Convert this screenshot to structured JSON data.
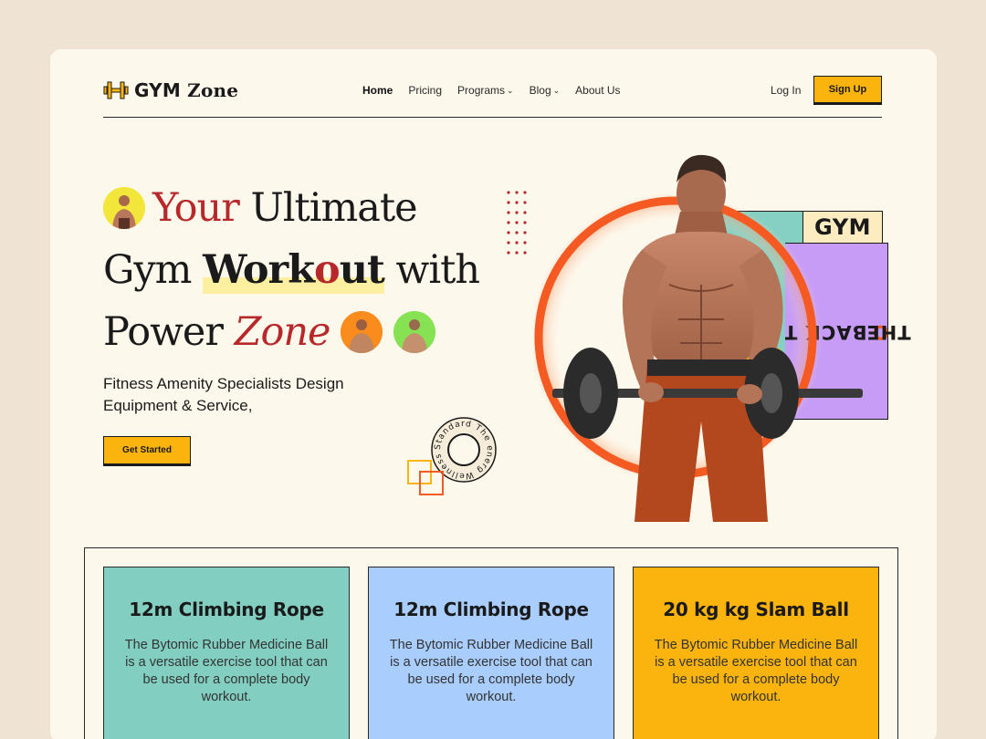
{
  "brand": {
    "name_main": "GYM",
    "name_accent": "Zone"
  },
  "nav": {
    "items": [
      {
        "label": "Home",
        "active": true,
        "dropdown": false
      },
      {
        "label": "Pricing",
        "active": false,
        "dropdown": false
      },
      {
        "label": "Programs",
        "active": false,
        "dropdown": true
      },
      {
        "label": "Blog",
        "active": false,
        "dropdown": true
      },
      {
        "label": "About Us",
        "active": false,
        "dropdown": false
      }
    ],
    "login_label": "Log In",
    "signup_label": "Sign Up"
  },
  "hero": {
    "headline": {
      "w1": "Your",
      "w2": "Ultimate",
      "w3": "Gym",
      "w4a": "Work",
      "w4b": "o",
      "w4c": "ut",
      "w5": "with",
      "w6": "Power",
      "w7": "Zone"
    },
    "subtitle": "Fitness Amenity Specialists Design Equipment & Service,",
    "cta_label": "Get Started",
    "badge_text": "Standard The energ Wellness ",
    "tag_gym": "GYM",
    "tag_back_a": "BACK T",
    "tag_back_b": "O",
    "tag_back_c": " THE"
  },
  "cards": [
    {
      "title": "12m Climbing Rope",
      "body": "The Bytomic Rubber Medicine Ball is a versatile exercise tool that can be used for a complete body workout.",
      "color": "#82cfc2"
    },
    {
      "title": "12m Climbing Rope",
      "body": "The Bytomic Rubber Medicine Ball is a versatile exercise tool that can be used for a complete body workout.",
      "color": "#a9cdfc"
    },
    {
      "title": "20 kg kg Slam Ball",
      "body": "The Bytomic Rubber Medicine Ball is a versatile exercise tool that can be used for a complete body workout.",
      "color": "#fbb40e"
    }
  ],
  "colors": {
    "accent_yellow": "#fbb40e",
    "accent_red": "#b7282b",
    "ring_orange": "#f55a22",
    "background": "#fdf8ec"
  }
}
